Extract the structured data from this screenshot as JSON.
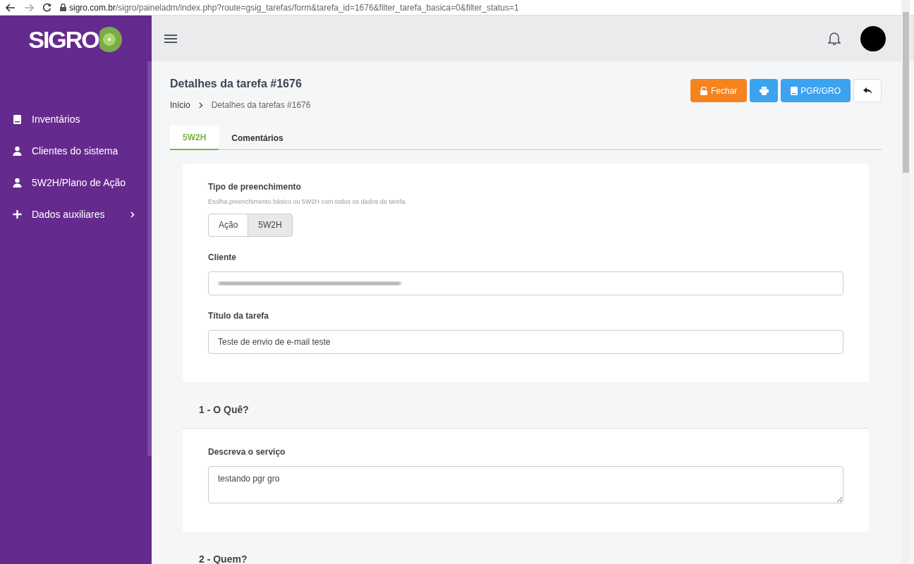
{
  "browser": {
    "url_host": "sigro.com.br",
    "url_path": "/sigro/paineladm/index.php?route=gsig_tarefas/form&tarefa_id=1676&filter_tarefa_basica=0&filter_status=1"
  },
  "sidebar": {
    "logo": "SIGRO",
    "items": [
      {
        "label": "Inventários",
        "kind": "link"
      },
      {
        "label": "Clientes do sistema",
        "kind": "link"
      },
      {
        "label": "5W2H/Plano de Ação",
        "kind": "link"
      },
      {
        "label": "Dados auxiliares",
        "kind": "submenu"
      }
    ]
  },
  "page": {
    "title": "Detalhes da tarefa #1676",
    "breadcrumb": [
      "Início",
      "Detalhes da tarefas #1676"
    ],
    "actions": [
      {
        "kind": "close",
        "label": "Fechar"
      },
      {
        "kind": "print"
      },
      {
        "kind": "pgr",
        "label": "PGR/GRO"
      },
      {
        "kind": "back"
      }
    ]
  },
  "tabs": [
    {
      "label": "5W2H",
      "selected": true
    },
    {
      "label": "Comentários",
      "selected": false
    }
  ],
  "form": {
    "type_label": "Tipo de preenchimento",
    "type_hint": "Esolha preenchimento básico ou 5W2H com todos os dados da tarefa.",
    "type_options": [
      {
        "label": "Ação",
        "selected": false
      },
      {
        "label": "5W2H",
        "selected": true
      }
    ],
    "client_label": "Cliente",
    "title_label": "Título da tarefa",
    "title_value": "Teste de envio de e-mail teste"
  },
  "sections": [
    {
      "title": "1 - O Quê?",
      "field_label": "Descreva o serviço",
      "field_value": "testando pgr gro"
    },
    {
      "title": "2 - Quem?"
    }
  ]
}
